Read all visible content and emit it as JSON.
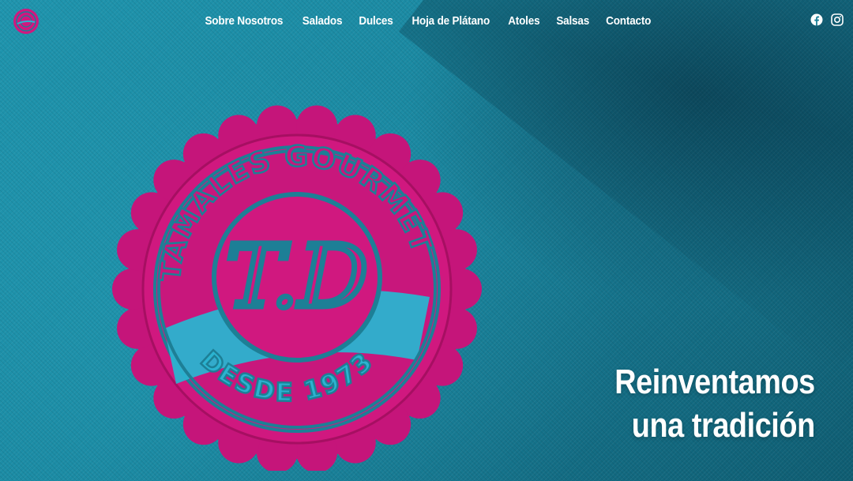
{
  "nav": {
    "links": [
      {
        "label": "Sobre Nosotros"
      },
      {
        "label": "Salados"
      },
      {
        "label": "Dulces"
      },
      {
        "label": "Hoja de Plátano"
      },
      {
        "label": "Atoles"
      },
      {
        "label": "Salsas"
      },
      {
        "label": "Contacto"
      }
    ]
  },
  "social": {
    "icons": [
      "facebook-icon",
      "instagram-icon"
    ]
  },
  "emblem": {
    "arc_text": "TAMALES GOURMET",
    "monogram": "T.D",
    "band_text": "DESDE 1973"
  },
  "hero": {
    "line1": "Reinventamos",
    "line2": "una tradición"
  },
  "colors": {
    "accent_magenta": "#d0187f",
    "fabric_teal": "#1a88a1",
    "band_cyan": "#2bb3d0"
  }
}
